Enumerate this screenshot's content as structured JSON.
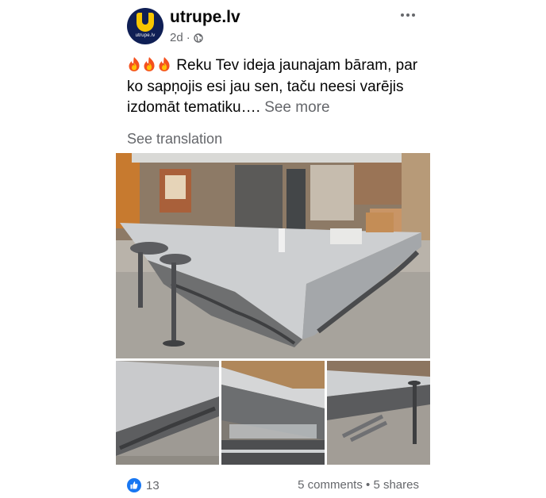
{
  "post": {
    "page_name": "utrupe.lv",
    "avatar": {
      "logo_letter": "u",
      "logo_text": "utrupe.lv"
    },
    "time": "2d",
    "time_separator": "·",
    "audience_icon": "globe-icon",
    "more_icon": "more-options-icon",
    "emoji": [
      "🔥",
      "🔥",
      "🔥"
    ],
    "text": "Reku Tev ideja jaunajam bāram, par ko sapņojis esi jau sen, taču neesi varējis izdomāt tematiku….",
    "see_more": "See more",
    "see_translation": "See translation"
  },
  "footer": {
    "reaction_icon": "like-icon",
    "reaction_count": "13",
    "comments": "5 comments",
    "separator": "•",
    "shares": "5 shares"
  },
  "colors": {
    "text": "#050505",
    "secondary": "#65676b",
    "like_blue": "#1877f2",
    "avatar_navy": "#0f1f55",
    "avatar_yellow": "#f7c600"
  }
}
